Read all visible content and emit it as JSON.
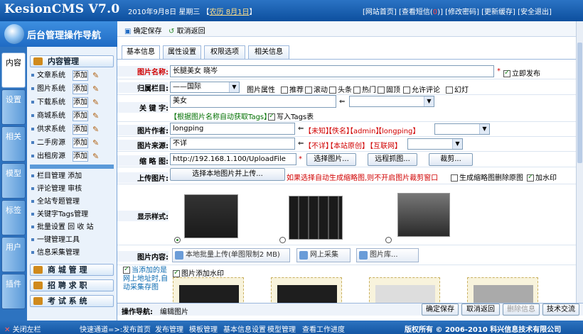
{
  "top": {
    "logo": "KesionCMS V7.0",
    "date": "2010年9月8日 星期三",
    "lunar": "农历 8月1日",
    "links": [
      "网站首页",
      "查看短信",
      "修改密码",
      "更新缓存",
      "安全退出"
    ],
    "msg_count": "0"
  },
  "nav": {
    "title": "后台管理操作导航",
    "tabs": [
      "内容",
      "设置",
      "相关",
      "模型",
      "标签",
      "用户",
      "插件"
    ],
    "content_group": "内容管理",
    "systems": [
      {
        "label": "文章系统",
        "add": "添加"
      },
      {
        "label": "图片系统",
        "add": "添加"
      },
      {
        "label": "下载系统",
        "add": "添加"
      },
      {
        "label": "商城系统",
        "add": "添加"
      },
      {
        "label": "供求系统",
        "add": "添加"
      },
      {
        "label": "二手房源",
        "add": "添加"
      },
      {
        "label": "出租房源",
        "add": "添加"
      }
    ],
    "tools": [
      "栏目管理 添加",
      "评论管理 审核",
      "全站专题管理",
      "关键字Tags管理",
      "批量设置 回 收 站",
      "一键管理工具",
      "信息采集管理"
    ],
    "groups": [
      "商 城 管 理",
      "招 聘 求 职",
      "考 试 系 统"
    ]
  },
  "toolbar": {
    "save": "确定保存",
    "cancel": "取消返回"
  },
  "tabs": [
    "基本信息",
    "属性设置",
    "权限选项",
    "相关信息"
  ],
  "form": {
    "name_label": "图片名称:",
    "name_value": "长腿美女 晓岑",
    "publish_now": "立即发布",
    "column_label": "归属栏目:",
    "column_value": "——国际",
    "attr_label": "图片属性",
    "attrs": [
      "推荐",
      "滚动",
      "头条",
      "热门",
      "固顶",
      "允许评论",
      "幻灯"
    ],
    "keyword_label": "关 键 字:",
    "keyword_value": "美女",
    "tags_hint": "【根据图片名称自动获取Tags】",
    "write_tags": "写入Tags表",
    "author_label": "图片作者:",
    "author_value": "longping",
    "author_opts": [
      "【未知】",
      "【佚名】",
      "【admin】",
      "【longping】"
    ],
    "source_label": "图片来源:",
    "source_value": "不详",
    "source_opts": [
      "【不详】",
      "【本站原创】",
      "【互联网】"
    ],
    "thumb_label": "缩 略 图:",
    "thumb_value": "http://192.168.1.100/UploadFile",
    "choose_pic": "选择图片...",
    "remote_pic": "远程抓图...",
    "crop": "裁剪...",
    "upload_label": "上传图片:",
    "upload_btn": "选择本地图片并上传...",
    "upload_hint": "如果选择自动生成缩略图,则不开启图片裁剪窗口",
    "gen_thumb": "生成缩略图删除原图",
    "watermark": "加水印",
    "style_label": "显示样式:",
    "content_label": "图片内容:",
    "batch_upload": "本地批量上传(单图限制2 MB)",
    "web_collect": "网上采集",
    "gallery": "图片库...",
    "auto_collect": "当添加的是网上地址时,自动采集存图",
    "pic_watermark": "图片添加水印"
  },
  "actbar": {
    "nav_label": "操作导航:",
    "nav_value": "编辑图片",
    "buttons": [
      "确定保存",
      "取消返回",
      "删除信息",
      "技术交流"
    ]
  },
  "footer": {
    "close_left": "关闭左栏",
    "quick_label": "快速通道=>:",
    "quick_links": [
      "发布首页",
      "发布管理",
      "模板管理",
      "基本信息设置",
      "模型管理",
      "查看工作进度"
    ],
    "copyright": "版权所有 © 2006-2010 科兴信息技术有限公司"
  },
  "colors": {
    "accent": "#1f6bc4",
    "required": "#d00000",
    "hint": "#007000"
  }
}
